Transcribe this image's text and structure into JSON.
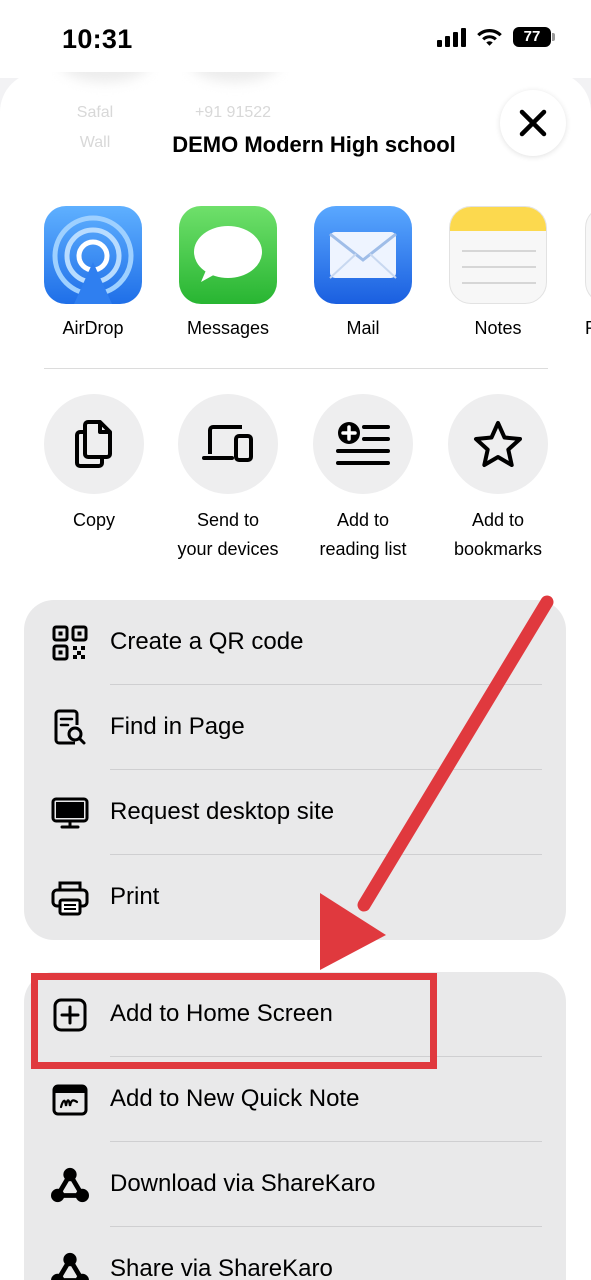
{
  "status_bar": {
    "time": "10:31",
    "battery": "77"
  },
  "background_ghost": {
    "contact_1": "Safal\nWall",
    "contact_2": "+91 91522"
  },
  "sheet": {
    "title": "DEMO Modern High school"
  },
  "apps": [
    {
      "label": "AirDrop",
      "icon": "airdrop-icon"
    },
    {
      "label": "Messages",
      "icon": "messages-icon"
    },
    {
      "label": "Mail",
      "icon": "mail-icon"
    },
    {
      "label": "Notes",
      "icon": "notes-icon"
    },
    {
      "label": "R",
      "icon": "reminders-icon"
    }
  ],
  "actions": [
    {
      "label_line1": "Copy",
      "label_line2": "",
      "icon": "copy-icon"
    },
    {
      "label_line1": "Send to",
      "label_line2": "your devices",
      "icon": "devices-icon"
    },
    {
      "label_line1": "Add to",
      "label_line2": "reading list",
      "icon": "reading-list-icon"
    },
    {
      "label_line1": "Add to",
      "label_line2": "bookmarks",
      "icon": "star-icon"
    }
  ],
  "menu_group_1": [
    {
      "label": "Create a QR code",
      "icon": "qr-code-icon"
    },
    {
      "label": "Find in Page",
      "icon": "find-in-page-icon"
    },
    {
      "label": "Request desktop site",
      "icon": "desktop-icon"
    },
    {
      "label": "Print",
      "icon": "printer-icon"
    }
  ],
  "menu_group_2": [
    {
      "label": "Add to Home Screen",
      "icon": "add-square-icon"
    },
    {
      "label": "Add to New Quick Note",
      "icon": "quick-note-icon"
    },
    {
      "label": "Download via ShareKaro",
      "icon": "sharekaro-icon"
    },
    {
      "label": "Share via ShareKaro",
      "icon": "sharekaro-icon"
    }
  ],
  "colors": {
    "annotation": "#e0393e",
    "group_bg": "#e9e9ea",
    "action_bg": "#eeeeef"
  }
}
